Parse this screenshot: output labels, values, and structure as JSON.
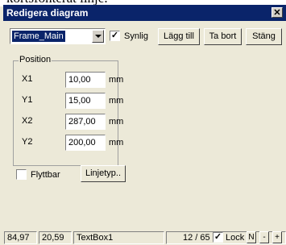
{
  "behind_text": "kortsfonterat linje.",
  "window": {
    "title": "Redigera diagram",
    "close_glyph": "✕"
  },
  "toolbar": {
    "frame_select": "Frame_Main",
    "visible_label": "Synlig",
    "visible_checked": true,
    "add_label": "Lägg till",
    "remove_label": "Ta bort",
    "close_label": "Stäng"
  },
  "position": {
    "legend": "Position",
    "rows": [
      {
        "label": "X1",
        "value": "10,00",
        "unit": "mm"
      },
      {
        "label": "Y1",
        "value": "15,00",
        "unit": "mm"
      },
      {
        "label": "X2",
        "value": "287,00",
        "unit": "mm"
      },
      {
        "label": "Y2",
        "value": "200,00",
        "unit": "mm"
      }
    ]
  },
  "movable": {
    "label": "Flyttbar",
    "checked": false
  },
  "line_type_label": "Linjetyp..",
  "status": {
    "x": "84,97",
    "y": "20,59",
    "object": "TextBox1",
    "page": "12 / 65",
    "lock_label": "Lock",
    "lock_checked": true,
    "n_label": "N",
    "minus_label": "-",
    "plus_label": "+"
  }
}
